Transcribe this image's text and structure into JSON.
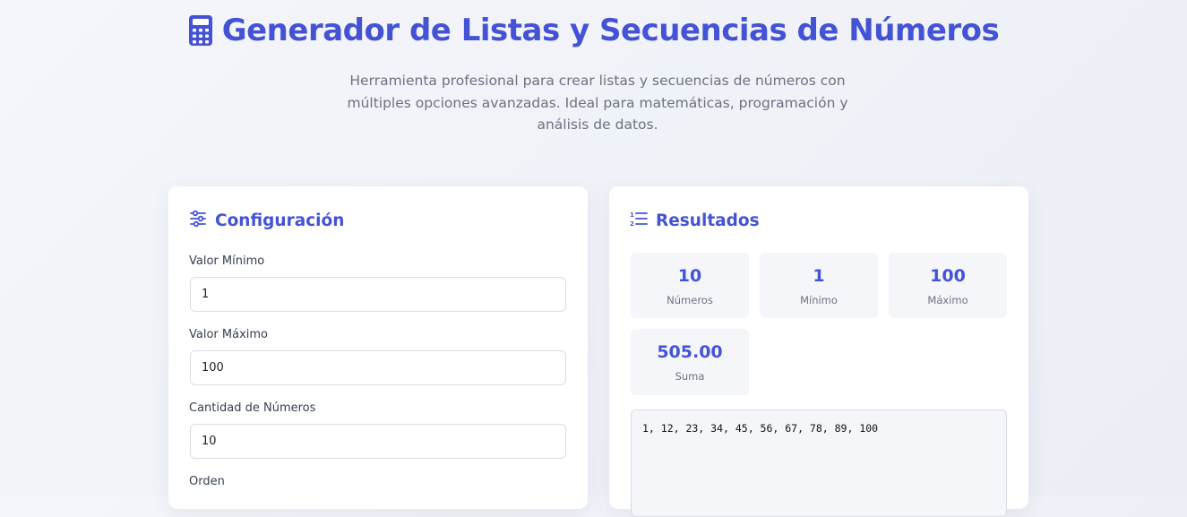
{
  "header": {
    "title": "Generador de Listas y Secuencias de Números",
    "subtitle": "Herramienta profesional para crear listas y secuencias de números con múltiples opciones avanzadas. Ideal para matemáticas, programación y análisis de datos.",
    "title_icon": "calculator-icon"
  },
  "config": {
    "title": "Configuración",
    "icon": "sliders-icon",
    "fields": [
      {
        "label": "Valor Mínimo",
        "value": "1"
      },
      {
        "label": "Valor Máximo",
        "value": "100"
      },
      {
        "label": "Cantidad de Números",
        "value": "10"
      },
      {
        "label": "Orden",
        "value": ""
      }
    ]
  },
  "results": {
    "title": "Resultados",
    "icon": "numbered-list-icon",
    "stats": [
      {
        "value": "10",
        "label": "Números"
      },
      {
        "value": "1",
        "label": "Mínimo"
      },
      {
        "value": "100",
        "label": "Máximo"
      },
      {
        "value": "505.00",
        "label": "Suma"
      }
    ],
    "output": "1, 12, 23, 34, 45, 56, 67, 78, 89, 100"
  },
  "colors": {
    "accent": "#4453d6",
    "background": "#f0f2f8",
    "muted": "#6b7280"
  }
}
